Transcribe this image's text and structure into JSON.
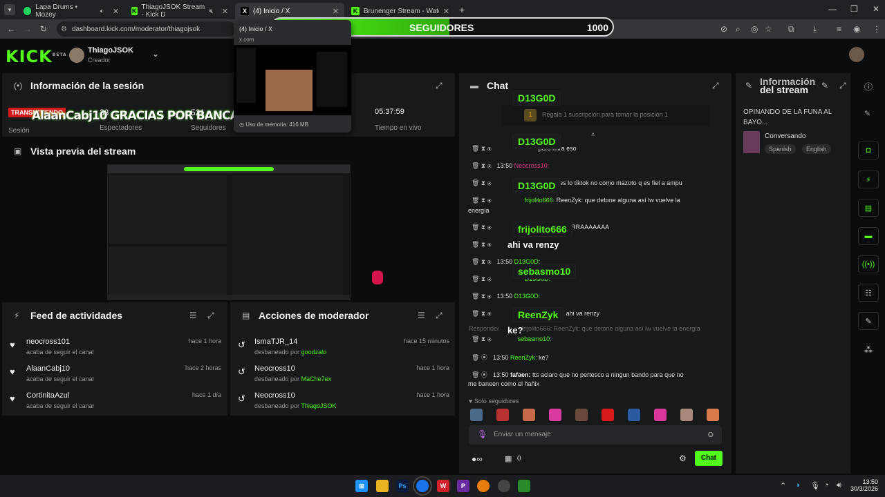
{
  "tabs": [
    {
      "label": "Lapa Drums • Mozey",
      "color": "#1ed760"
    },
    {
      "label": "ThiagoJSOK Stream - Kick D",
      "color": "#53fc18"
    },
    {
      "label": "(4) Inicio / X",
      "color": "#ffffff"
    },
    {
      "label": "Brunenger Stream - Watch Live",
      "color": "#53fc18"
    }
  ],
  "url": "dashboard.kick.com/moderator/thiagojsok",
  "hover": {
    "title": "(4) Inicio / X",
    "domain": "x.com",
    "memory": "Uso de memoria: 416 MB"
  },
  "followbar": {
    "current": "521",
    "label": "SEGUIDORES",
    "goal": "1000",
    "fill": 0.521
  },
  "header": {
    "logo": "KICK",
    "beta": "BETA",
    "username": "ThiagoJSOK",
    "role": "Creador"
  },
  "session": {
    "title": "Información de la sesión",
    "live_badge": "TRANSMITIENDO",
    "overlay": "AlaanCabj10 GRACIAS POR BANCAR PEDAZITO!!!",
    "session_label": "Sesión",
    "viewers": "38",
    "viewers_label": "Espectadores",
    "followers": "521",
    "followers_label": "Seguidores",
    "uptime": "05:37:59",
    "uptime_label": "Tiempo en vivo"
  },
  "preview": {
    "title": "Vista previa del stream"
  },
  "feed": {
    "title": "Feed de actividades",
    "items": [
      {
        "name": "neocross101",
        "sub": "acaba de seguir el canal",
        "time": "hace 1 hora"
      },
      {
        "name": "AlaanCabj10",
        "sub": "acaba de seguir el canal",
        "time": "hace 2 horas"
      },
      {
        "name": "CortinitaAzul",
        "sub": "acaba de seguir el canal",
        "time": "hace 1 día"
      }
    ]
  },
  "modactions": {
    "title": "Acciones de moderador",
    "items": [
      {
        "name": "IsmaTJR_14",
        "action": "desbaneado por",
        "by": "goodzalo",
        "time": "hace 15 minutos"
      },
      {
        "name": "Neocross10",
        "action": "desbaneado por",
        "by": "MaChe7ex",
        "time": "hace 1 hora"
      },
      {
        "name": "Neocross10",
        "action": "desbaneado por",
        "by": "ThiagoJSOK",
        "time": "hace 1 hora"
      }
    ]
  },
  "chat": {
    "title": "Chat",
    "pinned": "Regala 1 suscripción para tomar la posición 1",
    "lines": [
      {
        "time": "",
        "user": "",
        "text": "pero mira eso"
      },
      {
        "time": "13:50",
        "user": "Neocross10:",
        "text": ""
      },
      {
        "time": "",
        "user": "",
        "text": "s si haces lo tiktok no como mazoto q es fiel a ampu"
      },
      {
        "time": "",
        "user": "frijolito666:",
        "text": "ReenZyk: que detone alguna así lw vuelve la"
      },
      {
        "time": "",
        "user": "",
        "text": "energía"
      },
      {
        "time": "",
        "user": "",
        "text": "UE ZORRAAAAAAA"
      },
      {
        "time": "13:50",
        "user": "D13G0D:",
        "text": ""
      },
      {
        "time": "",
        "user": "D13G0D:",
        "text": ""
      },
      {
        "time": "13:50",
        "user": "D13G0D:",
        "text": ""
      },
      {
        "time": "",
        "user": "",
        "text": "ahi va renzy"
      },
      {
        "time": "",
        "user": "sebasmo10:",
        "text": ""
      },
      {
        "time": "13:50",
        "user": "ReenZyk:",
        "text": "ke?"
      },
      {
        "time": "13:50",
        "user": "fafaen:",
        "text": "tts aclaro que no pertesco a ningun bando para que no"
      },
      {
        "time": "",
        "user": "",
        "text": "me baneen como el ñañix"
      }
    ],
    "reply": "Responder",
    "reply_text": "frijolito666: ReenZyk: que detone alguna así lw vuelve la energía",
    "followers_only": "Solo seguidores",
    "placeholder": "Enviar un mensaje",
    "send": "Chat",
    "count": "0"
  },
  "overlay_chat": [
    {
      "user": "D13G0D"
    },
    {
      "user": "D13G0D"
    },
    {
      "user": "D13G0D"
    },
    {
      "user": "frijolito666"
    },
    {
      "text": "ahi va renzy"
    },
    {
      "user": "sebasmo10"
    },
    {
      "user": "ReenZyk"
    },
    {
      "text": "ke?"
    }
  ],
  "streaminfo": {
    "title": "Información del stream",
    "title2": "del stream",
    "title1": "Información",
    "stream_title": "OPINANDO DE LA FUNA AL BAYO...",
    "category": "Conversando",
    "tags": [
      "Spanish",
      "English"
    ]
  },
  "clock": {
    "time": "13:50",
    "date": "30/3/2026"
  }
}
